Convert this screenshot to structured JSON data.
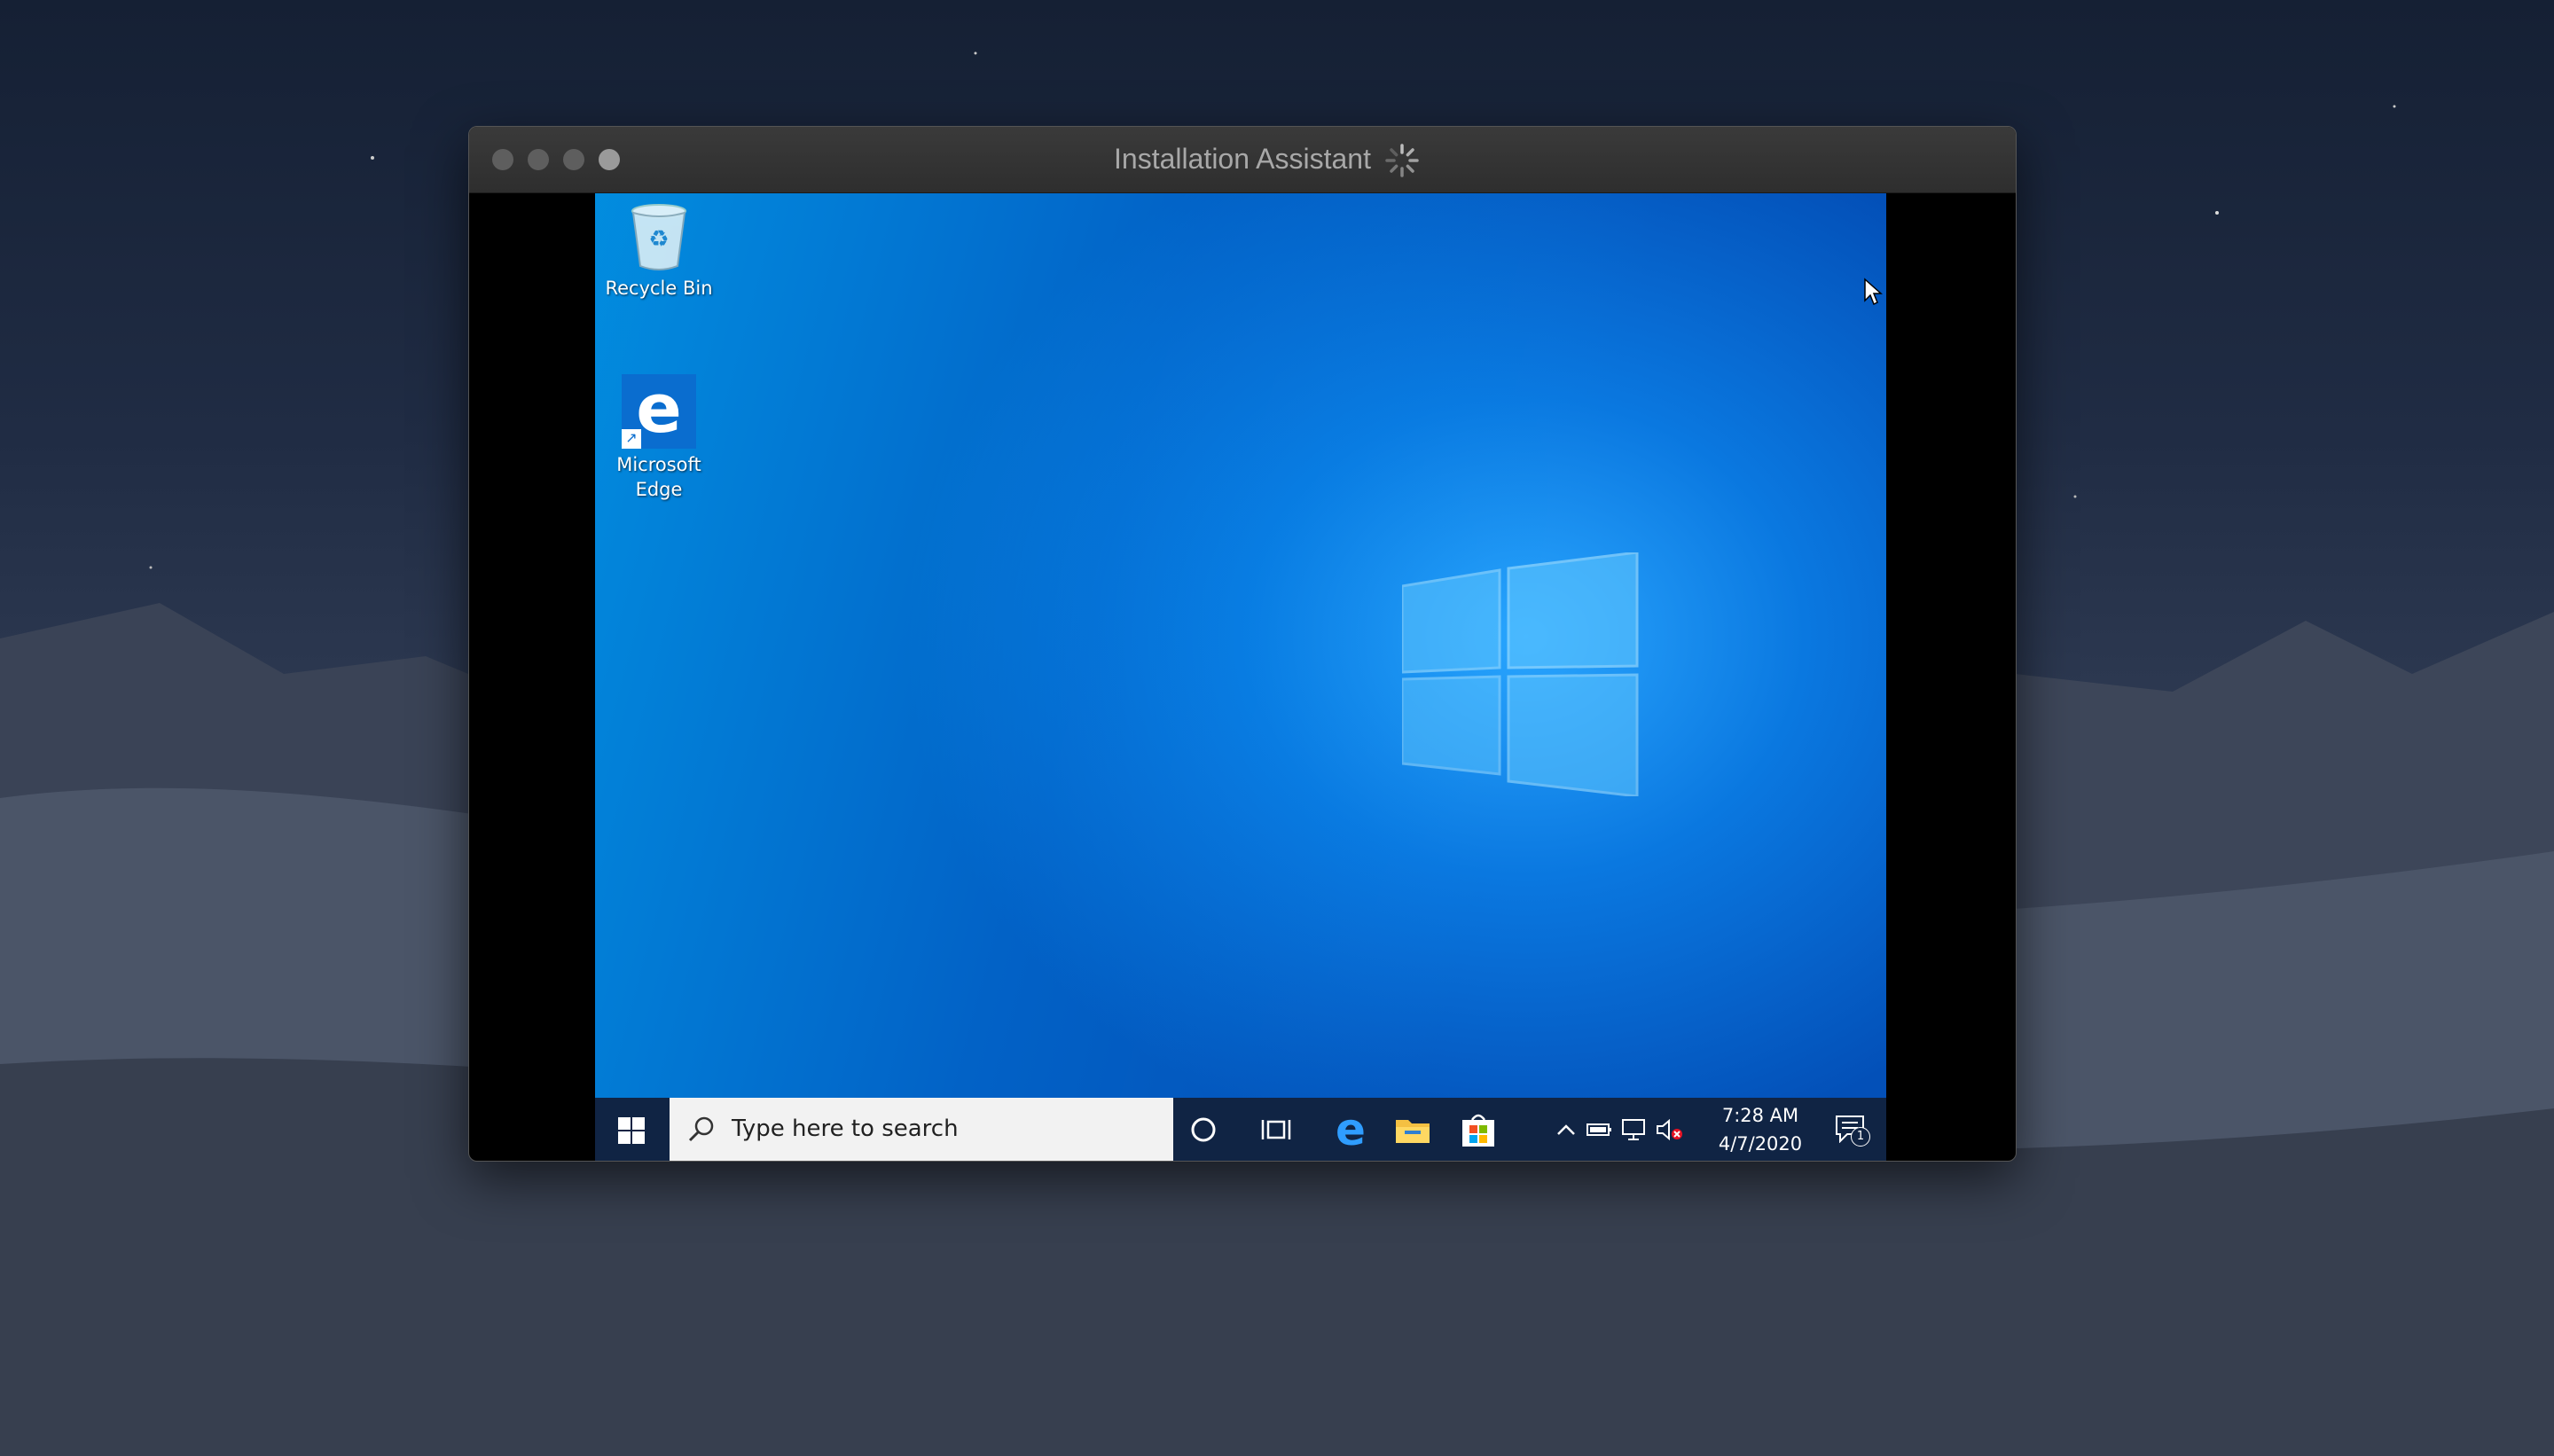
{
  "window": {
    "title": "Installation Assistant"
  },
  "desktop": {
    "icons": [
      {
        "label": "Recycle Bin",
        "icon": "recycle-bin-icon"
      },
      {
        "label": "Microsoft Edge",
        "icon": "edge-icon"
      }
    ]
  },
  "taskbar": {
    "search_placeholder": "Type here to search",
    "apps": [
      "cortana-icon",
      "task-view-icon",
      "edge-icon",
      "file-explorer-icon",
      "store-icon"
    ],
    "tray": {
      "time": "7:28 AM",
      "date": "4/7/2020",
      "notification_count": "1"
    }
  },
  "colors": {
    "desktop_accent": "#0a78e0",
    "taskbar": "#102444",
    "title_bar": "#333333"
  }
}
